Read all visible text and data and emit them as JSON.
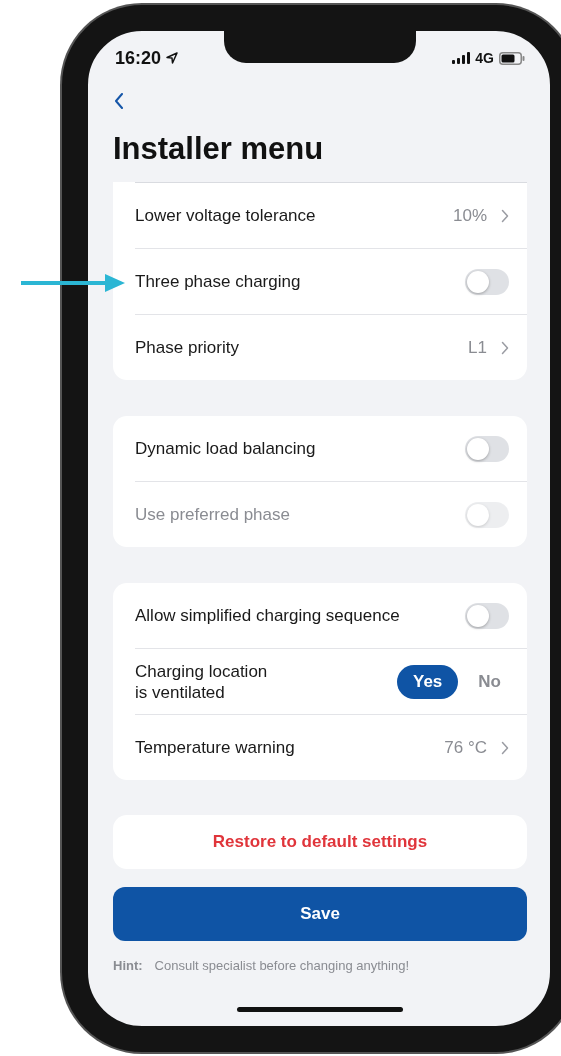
{
  "status_bar": {
    "time": "16:20",
    "network": "4G"
  },
  "title": "Installer menu",
  "groups": [
    {
      "cut_top": true,
      "rows": [
        {
          "kind": "value",
          "label": "Lower voltage tolerance",
          "value": "10%"
        },
        {
          "kind": "toggle",
          "label": "Three phase charging",
          "on": false,
          "disabled": false,
          "pointed": true
        },
        {
          "kind": "value",
          "label": "Phase priority",
          "value": "L1"
        }
      ]
    },
    {
      "cut_top": false,
      "rows": [
        {
          "kind": "toggle",
          "label": "Dynamic load balancing",
          "on": false,
          "disabled": false
        },
        {
          "kind": "toggle",
          "label": "Use preferred phase",
          "on": false,
          "disabled": true
        }
      ]
    },
    {
      "cut_top": false,
      "rows": [
        {
          "kind": "toggle",
          "label": "Allow simplified charging sequence",
          "on": false,
          "disabled": false
        },
        {
          "kind": "choice",
          "label": "Charging location\nis ventilated",
          "options": [
            {
              "label": "Yes",
              "selected": true
            },
            {
              "label": "No",
              "selected": false
            }
          ]
        },
        {
          "kind": "value",
          "label": "Temperature warning",
          "value": "76 °C"
        }
      ]
    }
  ],
  "restore_button": "Restore to default settings",
  "save_button": "Save",
  "hint": {
    "label": "Hint:",
    "text": "Consult specialist before changing anything!"
  }
}
